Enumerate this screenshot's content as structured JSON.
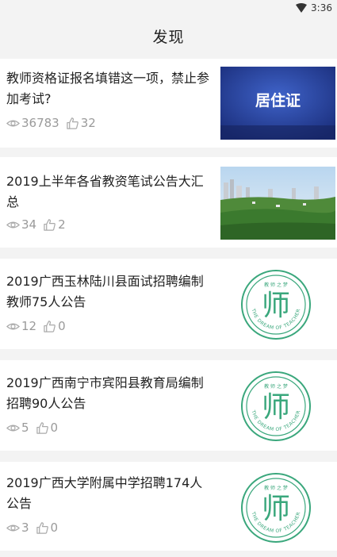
{
  "status": {
    "time": "3:36"
  },
  "header": {
    "title": "发现"
  },
  "articles": [
    {
      "title": "教师资格证报名填错这一项，禁止参加考试?",
      "views": "36783",
      "likes": "32",
      "thumb_text": "居住证"
    },
    {
      "title": "2019上半年各省教资笔试公告大汇总",
      "views": "34",
      "likes": "2"
    },
    {
      "title": "2019广西玉林陆川县面试招聘编制教师75人公告",
      "views": "12",
      "likes": "0",
      "logo_char": "师",
      "logo_top": "教 师 之 梦",
      "logo_ring": "THE DREAM OF TEACHER"
    },
    {
      "title": "2019广西南宁市宾阳县教育局编制招聘90人公告",
      "views": "5",
      "likes": "0",
      "logo_char": "师",
      "logo_top": "教 师 之 梦",
      "logo_ring": "THE DREAM OF TEACHER"
    },
    {
      "title": "2019广西大学附属中学招聘174人公告",
      "views": "3",
      "likes": "0",
      "logo_char": "师",
      "logo_top": "教 师 之 梦",
      "logo_ring": "THE DREAM OF TEACHER"
    }
  ]
}
